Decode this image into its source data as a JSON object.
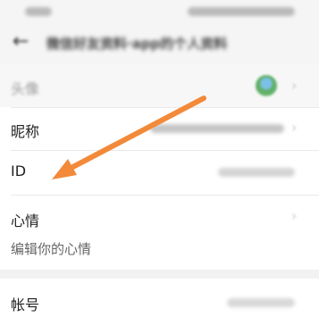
{
  "header": {
    "title": "微信好友资料·app的个人资料"
  },
  "rows": {
    "avatar_label": "头像",
    "nickname_label": "昵称",
    "id_label": "ID",
    "mood_label": "心情",
    "mood_placeholder": "编辑你的心情",
    "account_label": "帐号"
  },
  "colors": {
    "annotation_arrow": "#f28a3a",
    "background": "#f5f5f5",
    "row_background": "#ffffff"
  },
  "icons": [
    "back-icon",
    "avatar-image",
    "chevron-right-icon"
  ]
}
